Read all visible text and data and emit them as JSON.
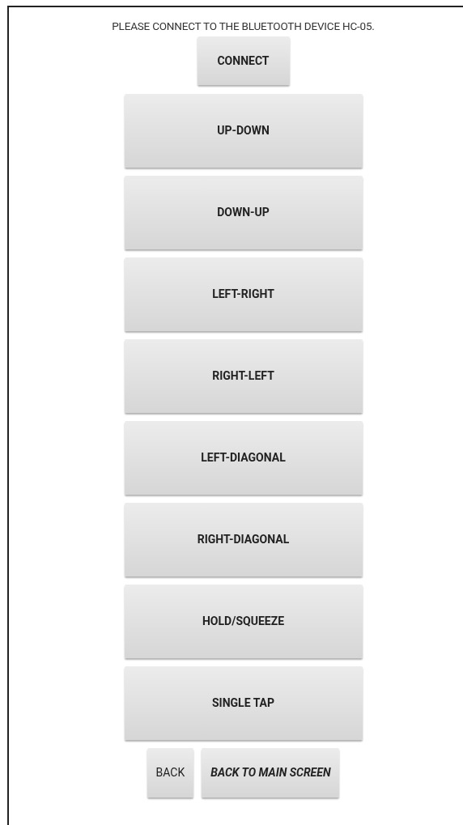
{
  "message": "PLEASE CONNECT TO THE BLUETOOTH DEVICE HC-05.",
  "connect_button": "CONNECT",
  "gesture_buttons": [
    "UP-DOWN",
    "DOWN-UP",
    "LEFT-RIGHT",
    "RIGHT-LEFT",
    "LEFT-DIAGONAL",
    "RIGHT-DIAGONAL",
    "HOLD/SQUEEZE",
    "SINGLE TAP"
  ],
  "bottom_buttons": [
    {
      "label": "BACK",
      "bold": false,
      "italic": false
    },
    {
      "label": "BACK TO MAIN SCREEN",
      "bold": true,
      "italic": true
    }
  ]
}
